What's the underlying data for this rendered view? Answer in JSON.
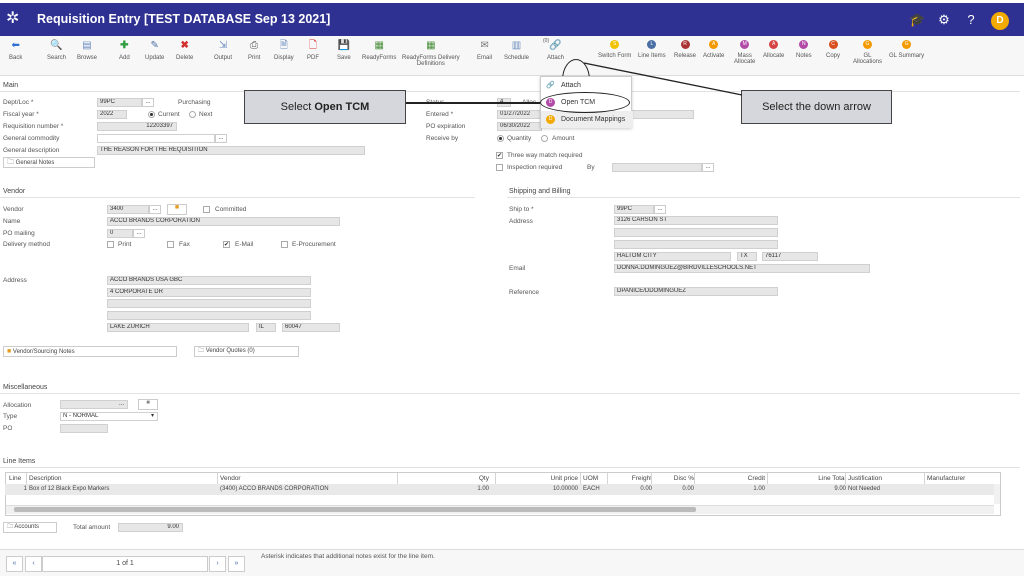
{
  "window": {
    "title": "Requisition Entry [TEST DATABASE Sep 13 2021]",
    "avatar": "D"
  },
  "toolbar": {
    "back": "Back",
    "search": "Search",
    "browse": "Browse",
    "add": "Add",
    "update": "Update",
    "delete": "Delete",
    "output": "Output",
    "print": "Print",
    "display": "Display",
    "pdf": "PDF",
    "save": "Save",
    "readyforms": "ReadyForms",
    "readyforms_delivery_1": "ReadyForms Delivery",
    "readyforms_delivery_2": "Definitions",
    "email": "Email",
    "schedule": "Schedule",
    "attach": "Attach",
    "attach_count": "(0)",
    "switch_form": "Switch Form",
    "line_items": "Line Items",
    "release": "Release",
    "activate": "Activate",
    "mass_allocate_1": "Mass",
    "mass_allocate_2": "Allocate",
    "allocate": "Allocate",
    "notes": "Notes",
    "copy": "Copy",
    "gl_allocations_1": "GL",
    "gl_allocations_2": "Allocations",
    "gl_summary": "GL Summary"
  },
  "dropdown": {
    "attach": "Attach",
    "open_tcm": "Open TCM",
    "document_mappings": "Document Mappings"
  },
  "callouts": {
    "select_open_prefix": "Select ",
    "select_open_bold": "Open TCM",
    "select_arrow": "Select the down arrow"
  },
  "main": {
    "heading": "Main",
    "dept_loc_label": "Dept/Loc *",
    "dept_loc": "99PC",
    "fiscal_year_label": "Fiscal year *",
    "fiscal_year": "2022",
    "purchasing_label": "Purchasing",
    "current": "Current",
    "next": "Next",
    "req_number_label": "Requisition number *",
    "req_number": "12203397",
    "general_commodity_label": "General commodity",
    "general_description_label": "General description",
    "general_description": "THE REASON FOR THE REQUISITION",
    "general_notes": "General Notes",
    "status_label": "Status",
    "status": "4",
    "alloc_label": "Alloc",
    "entered_label": "Entered *",
    "entered": "01/27/2022",
    "po_expiration_label": "PO expiration",
    "po_expiration": "06/30/2022",
    "receive_by_label": "Receive by",
    "quantity": "Quantity",
    "amount": "Amount",
    "three_way": "Three way match required",
    "inspection": "Inspection required",
    "by_label": "By"
  },
  "vendor": {
    "heading": "Vendor",
    "vendor_label": "Vendor",
    "vendor": "3400",
    "committed": "Committed",
    "name_label": "Name",
    "name": "ACCO BRANDS CORPORATION",
    "po_mailing_label": "PO mailing",
    "po_mailing": "0",
    "delivery_label": "Delivery method",
    "print": "Print",
    "fax": "Fax",
    "email": "E-Mail",
    "eproc": "E-Procurement",
    "address_label": "Address",
    "addr1": "ACCO BRANDS USA GBC",
    "addr2": "4 CORPORATE DR",
    "city": "LAKE ZURICH",
    "state": "IL",
    "zip": "60047",
    "sourcing_notes": "Vendor/Sourcing Notes",
    "quotes": "Vendor Quotes (0)"
  },
  "shipping": {
    "heading": "Shipping and Billing",
    "ship_to_label": "Ship to *",
    "ship_to": "99PC",
    "address_label": "Address",
    "addr1": "3126 CARSON ST",
    "city": "HALTOM CITY",
    "state": "TX",
    "zip": "76117",
    "email_label": "Email",
    "email": "DONNA.DOMINGUEZ@BIRDVILLESCHOOLS.NET",
    "reference_label": "Reference",
    "reference": "DPANICE/DDOMINGUEZ"
  },
  "misc": {
    "heading": "Miscellaneous",
    "allocation_label": "Allocation",
    "allocation": "...",
    "type_label": "Type",
    "type": "N - NORMAL",
    "po_label": "PO"
  },
  "line_items": {
    "heading": "Line Items",
    "columns": [
      "Line",
      "Description",
      "Vendor",
      "Qty",
      "Unit price",
      "UOM",
      "Freight",
      "Disc %",
      "Credit",
      "Line Total",
      "Justification",
      "Manufacturer"
    ],
    "row": [
      "1",
      "Box of 12 Black Expo Markers",
      "(3400) ACCO BRANDS CORPORATION",
      "1.00",
      "10.00000",
      "EACH",
      "0.00",
      "0.00",
      "1.00",
      "9.00",
      "Not Needed",
      ""
    ]
  },
  "footer": {
    "accounts": "Accounts",
    "total_amount_label": "Total amount",
    "total_amount": "9.00",
    "page": "1 of 1",
    "note": "Asterisk indicates that additional notes exist for the line item."
  }
}
